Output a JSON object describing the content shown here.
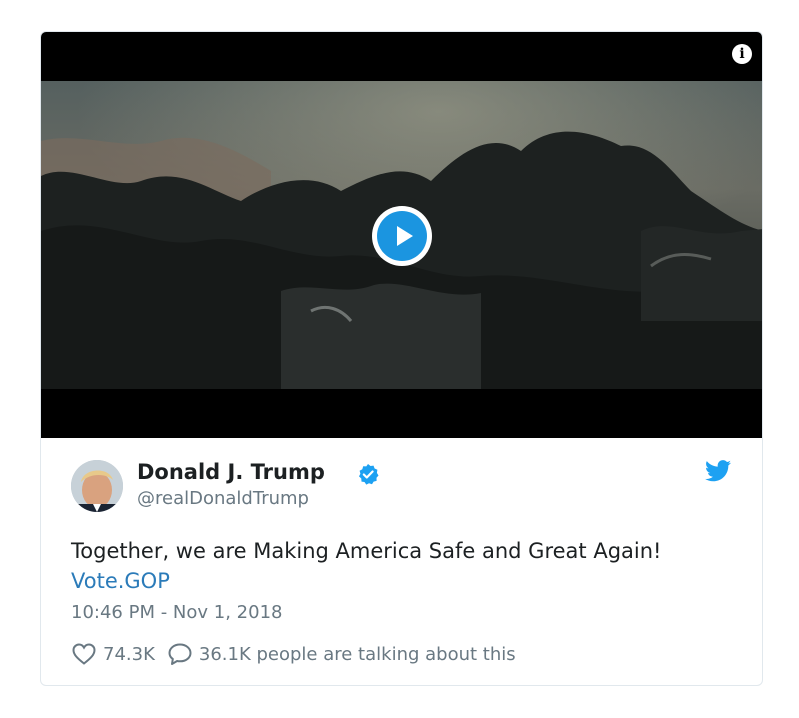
{
  "media": {
    "info_icon_glyph": "i",
    "play_icon": "play-icon"
  },
  "tweet": {
    "author_name": "Donald J. Trump",
    "handle": "@realDonaldTrump",
    "text": "Together, we are Making America Safe and Great Again!",
    "link_text": "Vote.GOP",
    "timestamp": "10:46 PM - Nov 1, 2018",
    "likes": "74.3K",
    "conversation": "36.1K people are talking about this"
  },
  "colors": {
    "accent": "#1b95e0",
    "link": "#2b7bb9",
    "muted_text": "#697882",
    "verified": "#1da1f2"
  }
}
